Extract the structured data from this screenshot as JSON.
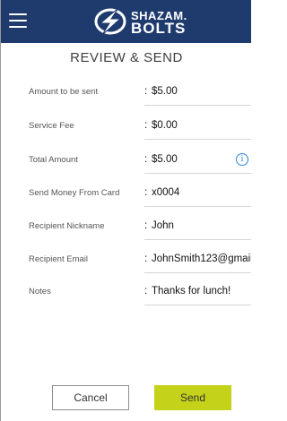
{
  "header": {
    "logo_line1": "SHAZAM.",
    "logo_line2": "BOLTS",
    "logo_icon": "bolt-logo-icon",
    "menu_icon": "hamburger-menu-icon"
  },
  "page_title": "REVIEW & SEND",
  "fields": [
    {
      "label": "Amount to be sent",
      "value": "$5.00"
    },
    {
      "label": "Service Fee",
      "value": "$0.00"
    },
    {
      "label": "Total Amount",
      "value": "$5.00"
    },
    {
      "label": "Send Money From Card",
      "value": "x0004"
    },
    {
      "label": "Recipient Nickname",
      "value": "John"
    },
    {
      "label": "Recipient Email",
      "value": "JohnSmith123@gmail"
    },
    {
      "label": "Notes",
      "value": "Thanks for lunch!"
    }
  ],
  "separator": ":",
  "info_icon": "info-icon",
  "info_glyph": "i",
  "buttons": {
    "cancel": "Cancel",
    "send": "Send"
  },
  "colors": {
    "header_bg": "#1f3b6e",
    "send_bg": "#c4d21a",
    "info_blue": "#2e86de"
  }
}
